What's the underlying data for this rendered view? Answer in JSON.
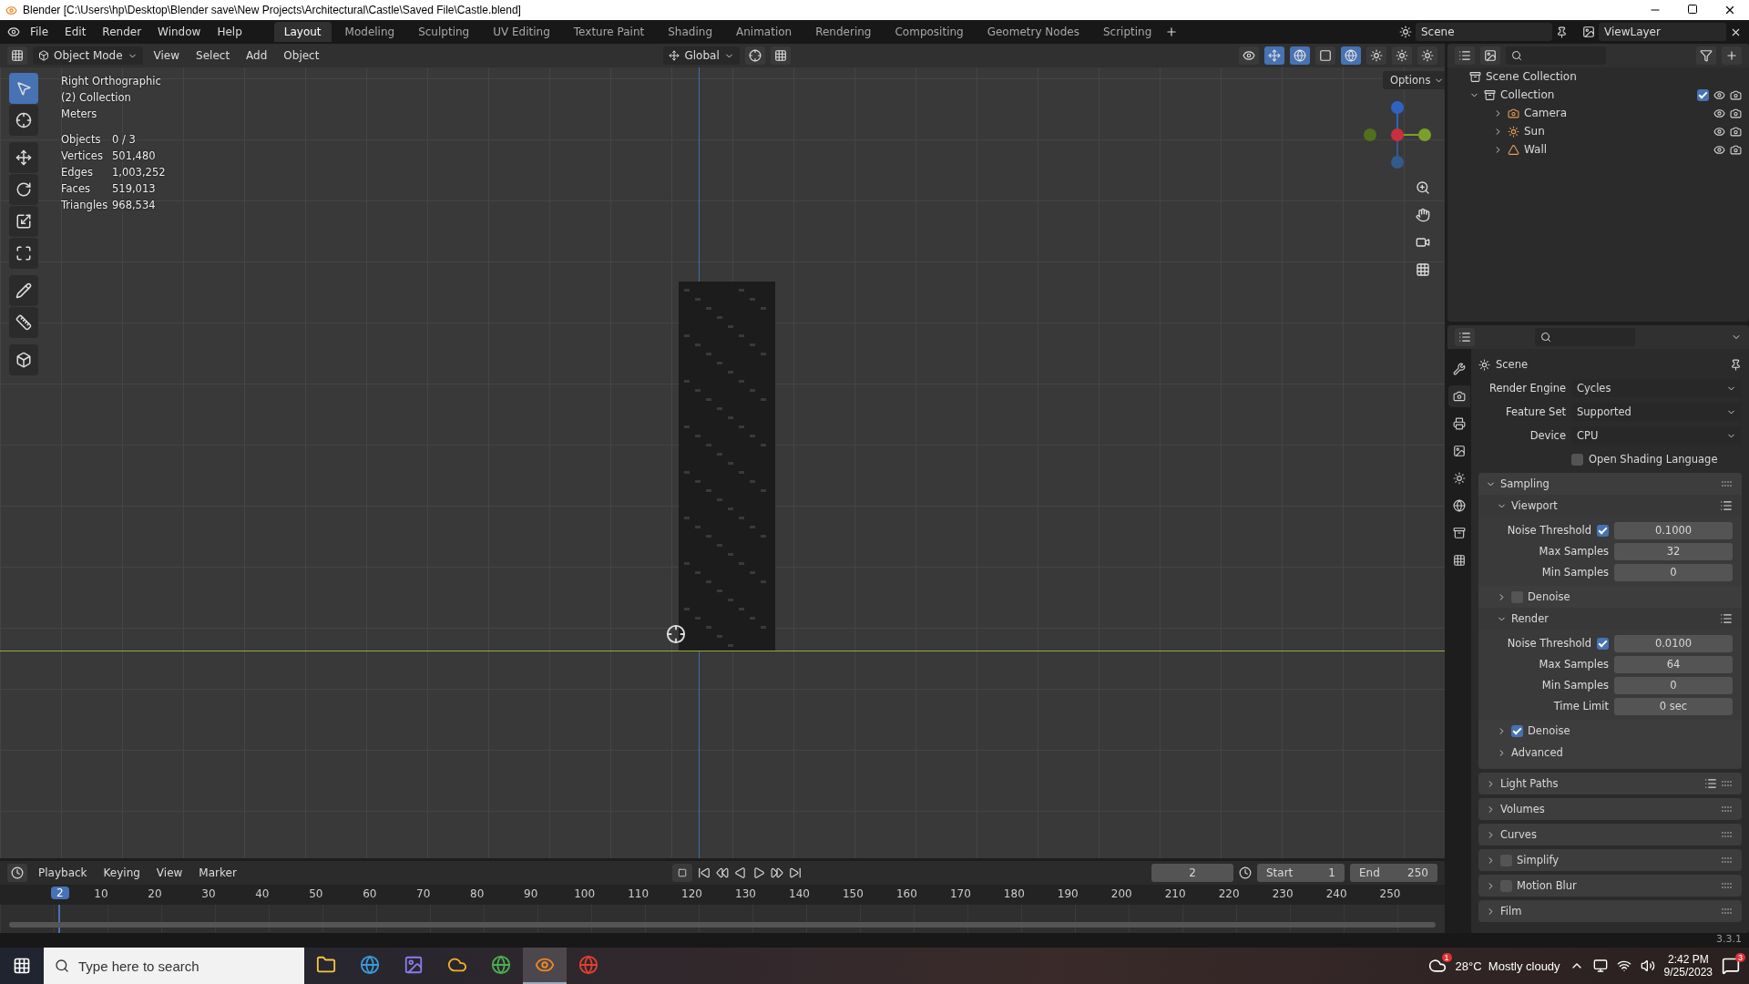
{
  "window": {
    "title": "Blender [C:\\Users\\hp\\Desktop\\Blender save\\New Projects\\Architectural\\Castle\\Saved File\\Castle.blend]"
  },
  "menu": [
    "File",
    "Edit",
    "Render",
    "Window",
    "Help"
  ],
  "workspaces": [
    {
      "label": "Layout",
      "selected": true
    },
    {
      "label": "Modeling",
      "selected": false
    },
    {
      "label": "Sculpting",
      "selected": false
    },
    {
      "label": "UV Editing",
      "selected": false
    },
    {
      "label": "Texture Paint",
      "selected": false
    },
    {
      "label": "Shading",
      "selected": false
    },
    {
      "label": "Animation",
      "selected": false
    },
    {
      "label": "Rendering",
      "selected": false
    },
    {
      "label": "Compositing",
      "selected": false
    },
    {
      "label": "Geometry Nodes",
      "selected": false
    },
    {
      "label": "Scripting",
      "selected": false
    }
  ],
  "scene_field": "Scene",
  "view_layer_field": "ViewLayer",
  "viewport": {
    "mode": "Object Mode",
    "menus": [
      "View",
      "Select",
      "Add",
      "Object"
    ],
    "orientation": "Global",
    "options": "Options",
    "info": [
      "Right Orthographic",
      "(2) Collection",
      "Meters"
    ],
    "stats": [
      {
        "label": "Objects",
        "value": "0 / 3"
      },
      {
        "label": "Vertices",
        "value": "501,480"
      },
      {
        "label": "Edges",
        "value": "1,003,252"
      },
      {
        "label": "Faces",
        "value": "519,013"
      },
      {
        "label": "Triangles",
        "value": "968,534"
      }
    ],
    "tools": [
      {
        "selected": true
      },
      {
        "selected": false
      },
      {
        "selected": false
      },
      {
        "selected": false
      },
      {
        "selected": false
      },
      {
        "selected": false
      },
      {
        "selected": false
      },
      {
        "selected": false
      },
      {
        "selected": false
      }
    ]
  },
  "outliner": {
    "root": "Scene Collection",
    "items": [
      {
        "name": "Collection",
        "expanded": true,
        "checked": true,
        "children": [
          {
            "name": "Camera",
            "expanded": false
          },
          {
            "name": "Sun",
            "expanded": false
          },
          {
            "name": "Wall",
            "expanded": false
          }
        ]
      }
    ]
  },
  "properties": {
    "title": "Scene",
    "fields": [
      {
        "label": "Render Engine",
        "value": "Cycles"
      },
      {
        "label": "Feature Set",
        "value": "Supported"
      },
      {
        "label": "Device",
        "value": "CPU"
      }
    ],
    "osl": {
      "label": "Open Shading Language",
      "checked": false
    },
    "panels": [
      {
        "title": "Sampling",
        "expanded": true,
        "subpanels": [
          {
            "title": "Viewport",
            "expanded": true,
            "presets": true,
            "rows": [
              {
                "kind": "check-number",
                "label": "Noise Threshold",
                "checked": true,
                "value": "0.1000"
              },
              {
                "kind": "number",
                "label": "Max Samples",
                "value": "32"
              },
              {
                "kind": "number",
                "label": "Min Samples",
                "value": "0"
              }
            ]
          },
          {
            "title": "Denoise",
            "expanded": false,
            "checked": false
          },
          {
            "title": "Render",
            "expanded": true,
            "presets": true,
            "rows": [
              {
                "kind": "check-number",
                "label": "Noise Threshold",
                "checked": true,
                "value": "0.0100"
              },
              {
                "kind": "number",
                "label": "Max Samples",
                "value": "64"
              },
              {
                "kind": "number",
                "label": "Min Samples",
                "value": "0"
              },
              {
                "kind": "number",
                "label": "Time Limit",
                "value": "0 sec"
              }
            ]
          },
          {
            "title": "Denoise",
            "expanded": false,
            "checked": true
          },
          {
            "title": "Advanced",
            "expanded": false
          }
        ]
      },
      {
        "title": "Light Paths",
        "expanded": false,
        "presets": true
      },
      {
        "title": "Volumes",
        "expanded": false
      },
      {
        "title": "Curves",
        "expanded": false
      },
      {
        "title": "Simplify",
        "expanded": false,
        "checked": false
      },
      {
        "title": "Motion Blur",
        "expanded": false,
        "checked": false
      },
      {
        "title": "Film",
        "expanded": false
      }
    ]
  },
  "timeline": {
    "menus": [
      "Playback",
      "Keying",
      "View",
      "Marker"
    ],
    "current_frame": "2",
    "start_label": "Start",
    "start": "1",
    "end_label": "End",
    "end": "250",
    "ruler_current": "2",
    "ruler": [
      "10",
      "20",
      "30",
      "40",
      "50",
      "60",
      "70",
      "80",
      "90",
      "100",
      "110",
      "120",
      "130",
      "140",
      "150",
      "160",
      "170",
      "180",
      "190",
      "200",
      "210",
      "220",
      "230",
      "240",
      "250"
    ]
  },
  "status_bar": {
    "version": "3.3.1"
  },
  "taskbar": {
    "search_placeholder": "Type here to search",
    "apps": [
      {
        "selected": false
      },
      {
        "selected": false
      },
      {
        "selected": false
      },
      {
        "selected": false
      },
      {
        "selected": false
      },
      {
        "selected": true
      },
      {
        "selected": false
      }
    ],
    "weather": "28°C  Mostly cloudy",
    "weather_badge": "1",
    "time": "2:42 PM",
    "date": "9/25/2023",
    "notifications": "3"
  }
}
